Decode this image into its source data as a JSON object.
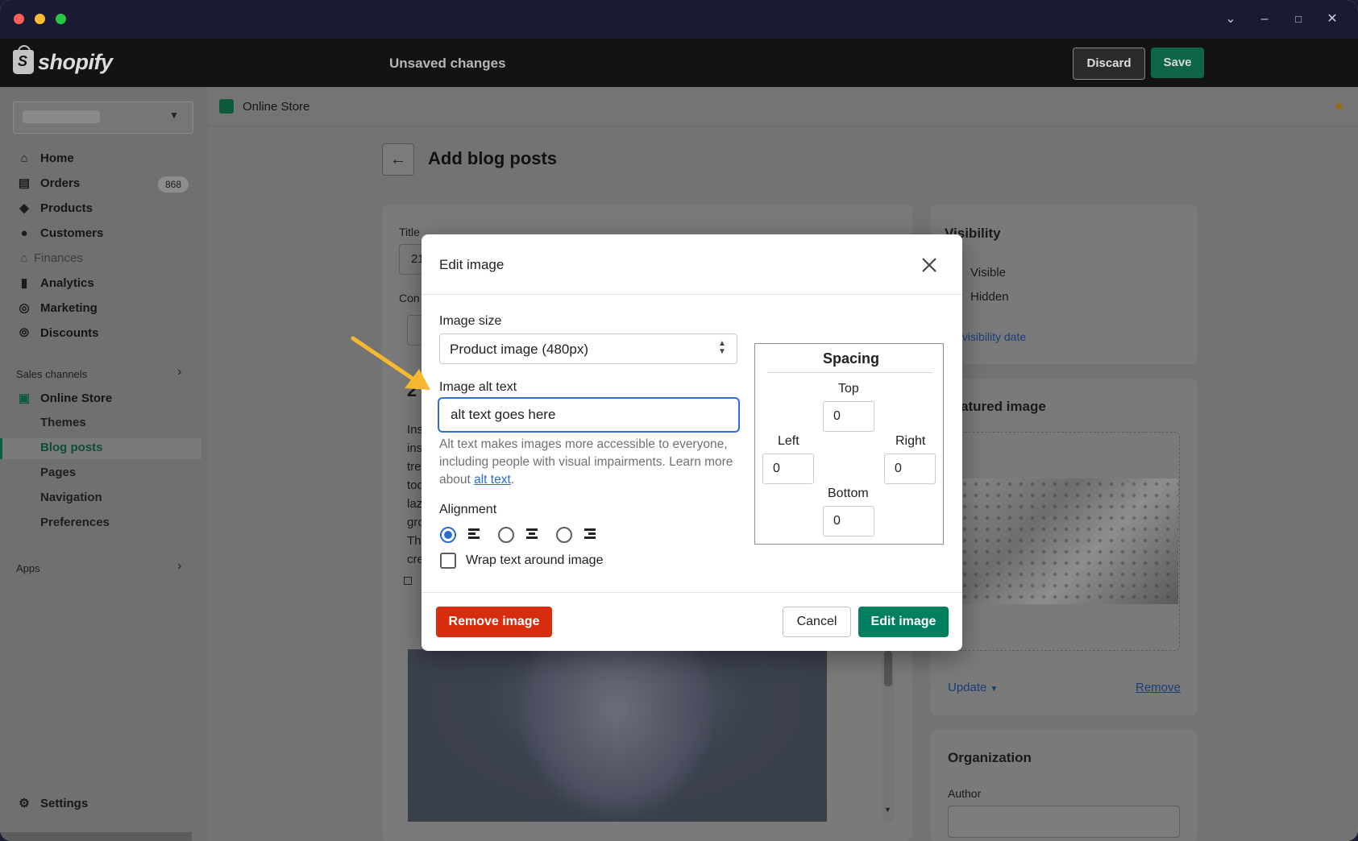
{
  "window": {
    "controls": [
      "close",
      "minimize",
      "maximize"
    ],
    "right_controls": [
      "chevron-down-icon",
      "minimize-icon",
      "restore-icon",
      "close-icon"
    ]
  },
  "topbar": {
    "brand": "shopify",
    "status": "Unsaved changes",
    "discard_label": "Discard",
    "save_label": "Save"
  },
  "sidebar": {
    "items": [
      {
        "label": "Home",
        "icon": "home-icon"
      },
      {
        "label": "Orders",
        "icon": "orders-icon",
        "badge": "868"
      },
      {
        "label": "Products",
        "icon": "tag-icon"
      },
      {
        "label": "Customers",
        "icon": "person-icon"
      },
      {
        "label": "Finances",
        "icon": "bank-icon"
      },
      {
        "label": "Analytics",
        "icon": "bar-chart-icon"
      },
      {
        "label": "Marketing",
        "icon": "target-icon"
      },
      {
        "label": "Discounts",
        "icon": "discount-icon"
      }
    ],
    "sales_channels_label": "Sales channels",
    "online_store_label": "Online Store",
    "sub_items": [
      "Themes",
      "Blog posts",
      "Pages",
      "Navigation",
      "Preferences"
    ],
    "apps_label": "Apps",
    "settings_label": "Settings"
  },
  "breadcrumb": {
    "label": "Online Store"
  },
  "page": {
    "title": "Add blog posts",
    "editor": {
      "title_label": "Title",
      "title_value_fragment": "21",
      "content_label": "Con",
      "content_fragments": [
        "Ins",
        "ins",
        "tre",
        "too",
        "laz",
        "gro",
        "Th",
        "cre"
      ]
    },
    "visibility": {
      "title": "Visibility",
      "options": [
        "Visible",
        "Hidden"
      ],
      "link": "t visibility date"
    },
    "featured": {
      "title": "atured image",
      "update_label": "Update",
      "remove_label": "Remove"
    },
    "organization": {
      "title": "Organization",
      "author_label": "Author"
    }
  },
  "modal": {
    "title": "Edit image",
    "image_size_label": "Image size",
    "image_size_value": "Product image (480px)",
    "alt_label": "Image alt text",
    "alt_value": "alt text goes here",
    "alt_help": "Alt text makes images more accessible to everyone, including people with visual impairments. Learn more about ",
    "alt_link": "alt text",
    "alt_help_end": ".",
    "alignment_label": "Alignment",
    "alignment_options": [
      "left",
      "center",
      "right"
    ],
    "alignment_selected": "left",
    "wrap_label": "Wrap text around image",
    "wrap_checked": false,
    "spacing": {
      "title": "Spacing",
      "top_label": "Top",
      "top_value": "0",
      "left_label": "Left",
      "left_value": "0",
      "right_label": "Right",
      "right_value": "0",
      "bottom_label": "Bottom",
      "bottom_value": "0"
    },
    "remove_label": "Remove image",
    "cancel_label": "Cancel",
    "edit_label": "Edit image"
  },
  "colors": {
    "accent_green": "#008060",
    "danger": "#d72c0d",
    "focus_blue": "#2e6fdb",
    "annotation_arrow": "#f5b82e"
  }
}
